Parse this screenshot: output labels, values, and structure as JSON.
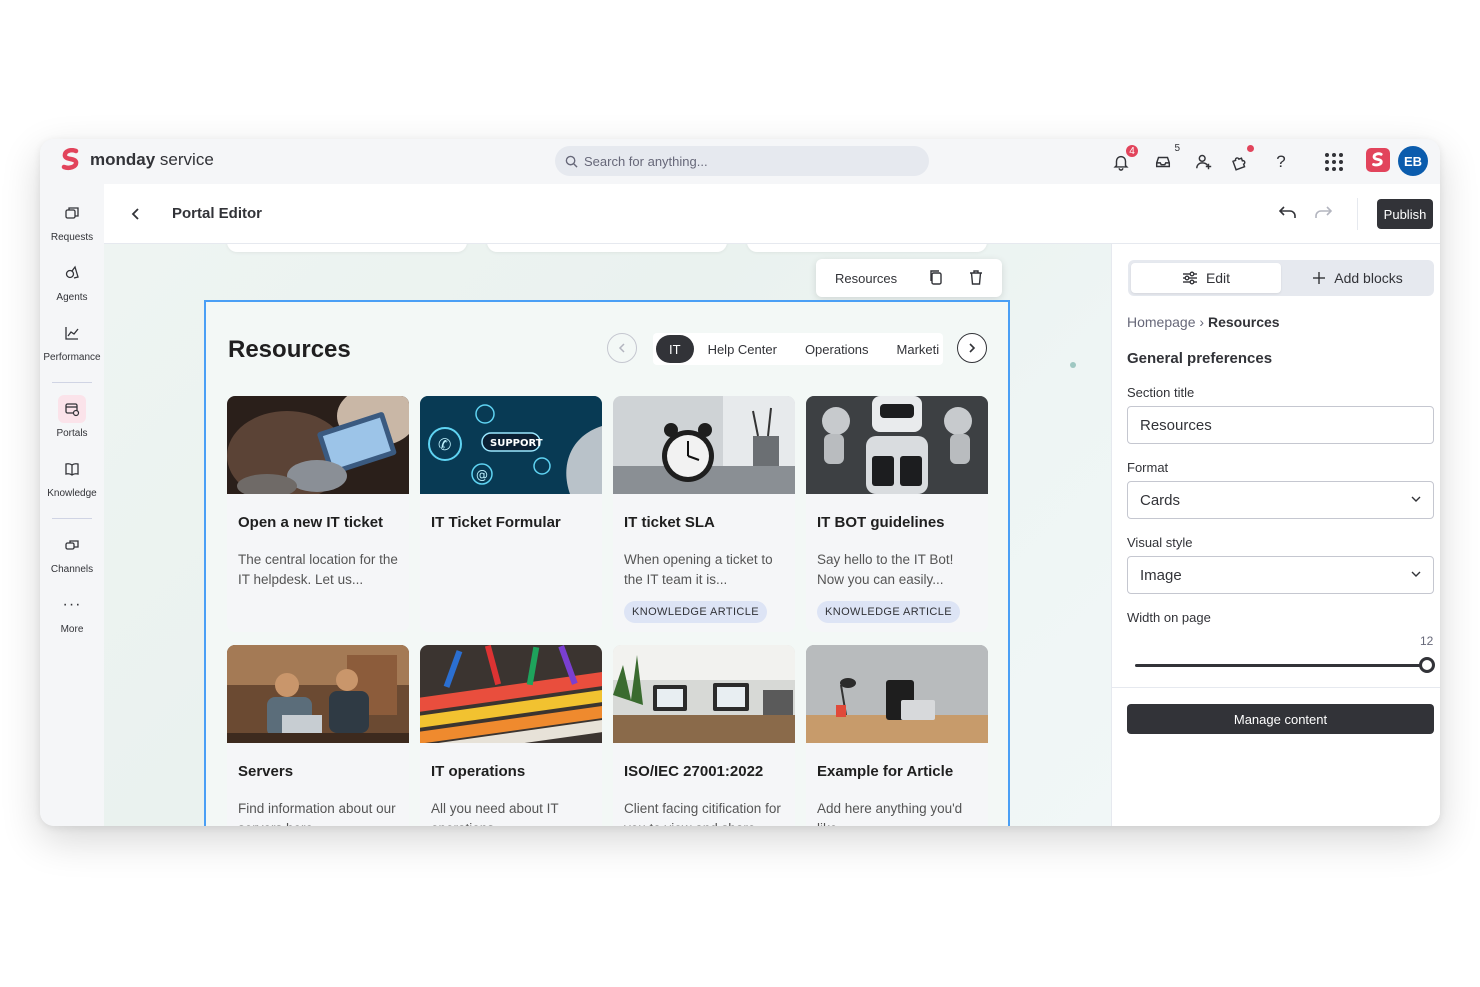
{
  "app": {
    "brand_bold": "monday",
    "brand_rest": "service"
  },
  "search": {
    "placeholder": "Search for anything..."
  },
  "topbar": {
    "notifications_count": "4",
    "inbox_count": "5",
    "avatar_initials": "EB"
  },
  "sidebar": {
    "items": [
      {
        "label": "Requests",
        "icon": "requests-icon"
      },
      {
        "label": "Agents",
        "icon": "agents-icon"
      },
      {
        "label": "Performance",
        "icon": "performance-icon"
      },
      {
        "label": "Portals",
        "icon": "portals-icon",
        "active": true
      },
      {
        "label": "Knowledge",
        "icon": "knowledge-icon"
      },
      {
        "label": "Channels",
        "icon": "channels-icon"
      },
      {
        "label": "More",
        "icon": "more-icon"
      }
    ]
  },
  "editor": {
    "title": "Portal Editor",
    "publish_label": "Publish"
  },
  "toolbar": {
    "label": "Resources"
  },
  "section": {
    "title": "Resources",
    "tabs": [
      "IT",
      "Help Center",
      "Operations",
      "Marketi"
    ],
    "active_tab": "IT",
    "cards": [
      {
        "title": "Open a new IT ticket",
        "desc": "The central location for the IT helpdesk. Let us...",
        "tag": ""
      },
      {
        "title": "IT Ticket Formular",
        "desc": "",
        "tag": ""
      },
      {
        "title": "IT ticket SLA",
        "desc": "When opening a ticket to the IT team it is...",
        "tag": "KNOWLEDGE ARTICLE"
      },
      {
        "title": "IT BOT guidelines",
        "desc": "Say hello to the IT Bot! Now you can easily...",
        "tag": "KNOWLEDGE ARTICLE"
      },
      {
        "title": "Servers",
        "desc": "Find information about our servers here",
        "tag": ""
      },
      {
        "title": "IT operations",
        "desc": "All you need about IT operations",
        "tag": ""
      },
      {
        "title": "ISO/IEC 27001:2022",
        "desc": "Client facing citification for you to view and share",
        "tag": ""
      },
      {
        "title": "Example for Article",
        "desc": "Add here anything you'd like",
        "tag": ""
      }
    ]
  },
  "panel": {
    "edit_label": "Edit",
    "add_blocks_label": "Add blocks",
    "breadcrumb_root": "Homepage",
    "breadcrumb_sep": "›",
    "breadcrumb_current": "Resources",
    "heading": "General preferences",
    "section_title_label": "Section title",
    "section_title_value": "Resources",
    "format_label": "Format",
    "format_value": "Cards",
    "visual_style_label": "Visual style",
    "visual_style_value": "Image",
    "width_label": "Width on page",
    "width_value": "12",
    "manage_label": "Manage content"
  },
  "colors": {
    "accent": "#4a9ff5",
    "brand": "#e2445c",
    "dark": "#323338"
  }
}
